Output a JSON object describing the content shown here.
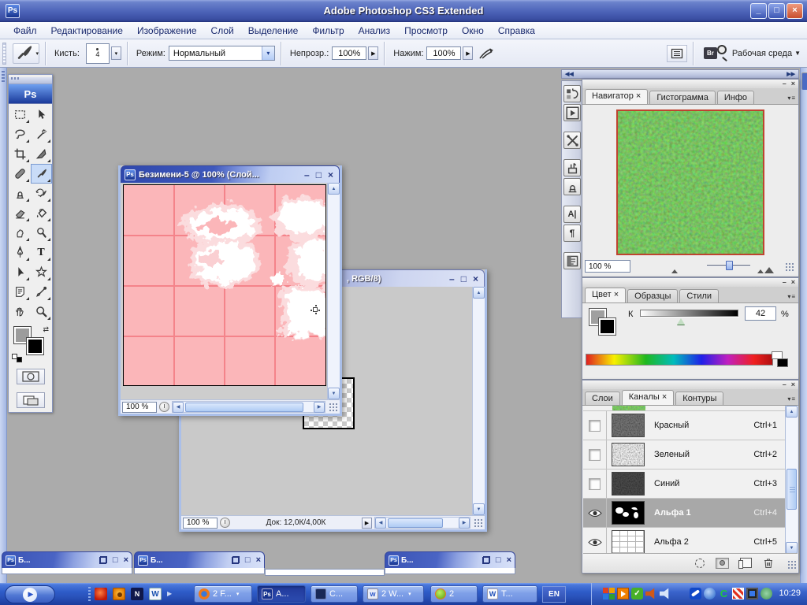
{
  "app": {
    "badge": "Ps",
    "title": "Adobe Photoshop CS3 Extended"
  },
  "glyphs": {
    "minimize": "–",
    "maximize": "□",
    "close": "×",
    "dropdown": "▾",
    "dropdown_big": "▼",
    "play": "▶",
    "left": "◀",
    "right": "▶",
    "up": "▲",
    "down": "▼",
    "dock_collapse": "◀◀",
    "dock_expand": "▶▶",
    "menu_lines": "≡",
    "underscore": "_"
  },
  "menu": {
    "items": [
      "Файл",
      "Редактирование",
      "Изображение",
      "Слой",
      "Выделение",
      "Фильтр",
      "Анализ",
      "Просмотр",
      "Окно",
      "Справка"
    ]
  },
  "options": {
    "brush_label": "Кисть:",
    "brush_size": "4",
    "mode_label": "Режим:",
    "mode_value": "Нормальный",
    "opacity_label": "Непрозр.:",
    "opacity_value": "100%",
    "flow_label": "Нажим:",
    "flow_value": "100%",
    "workspace_label": "Рабочая среда"
  },
  "doc1": {
    "title": "Безимени-5 @ 100% (Слой...",
    "zoom": "100 %"
  },
  "doc2": {
    "title_visible": ", RGB/8)",
    "zoom": "100 %",
    "doc_size": "Док: 12,0К/4,00К"
  },
  "navigator": {
    "tabs": {
      "active": "Навигатор ×",
      "t2": "Гистограмма",
      "t3": "Инфо"
    },
    "zoom": "100 %"
  },
  "color": {
    "tabs": {
      "active": "Цвет ×",
      "t2": "Образцы",
      "t3": "Стили"
    },
    "channel": "К",
    "value": "42",
    "unit": "%"
  },
  "channels": {
    "tabs": {
      "t1": "Слои",
      "active": "Каналы ×",
      "t3": "Контуры"
    },
    "rows": [
      {
        "name": "Красный",
        "key": "Ctrl+1"
      },
      {
        "name": "Зеленый",
        "key": "Ctrl+2"
      },
      {
        "name": "Синий",
        "key": "Ctrl+3"
      },
      {
        "name": "Альфа 1",
        "key": "Ctrl+4"
      },
      {
        "name": "Альфа 2",
        "key": "Ctrl+5"
      }
    ]
  },
  "miniwin": {
    "label": "Б..."
  },
  "taskbar": {
    "tasks": {
      "firefox": "2 F...",
      "photoshop": "A...",
      "book": "C...",
      "explorer": "2 W...",
      "icq": "2",
      "word": "T..."
    },
    "language": "EN",
    "clock": "10:29"
  }
}
